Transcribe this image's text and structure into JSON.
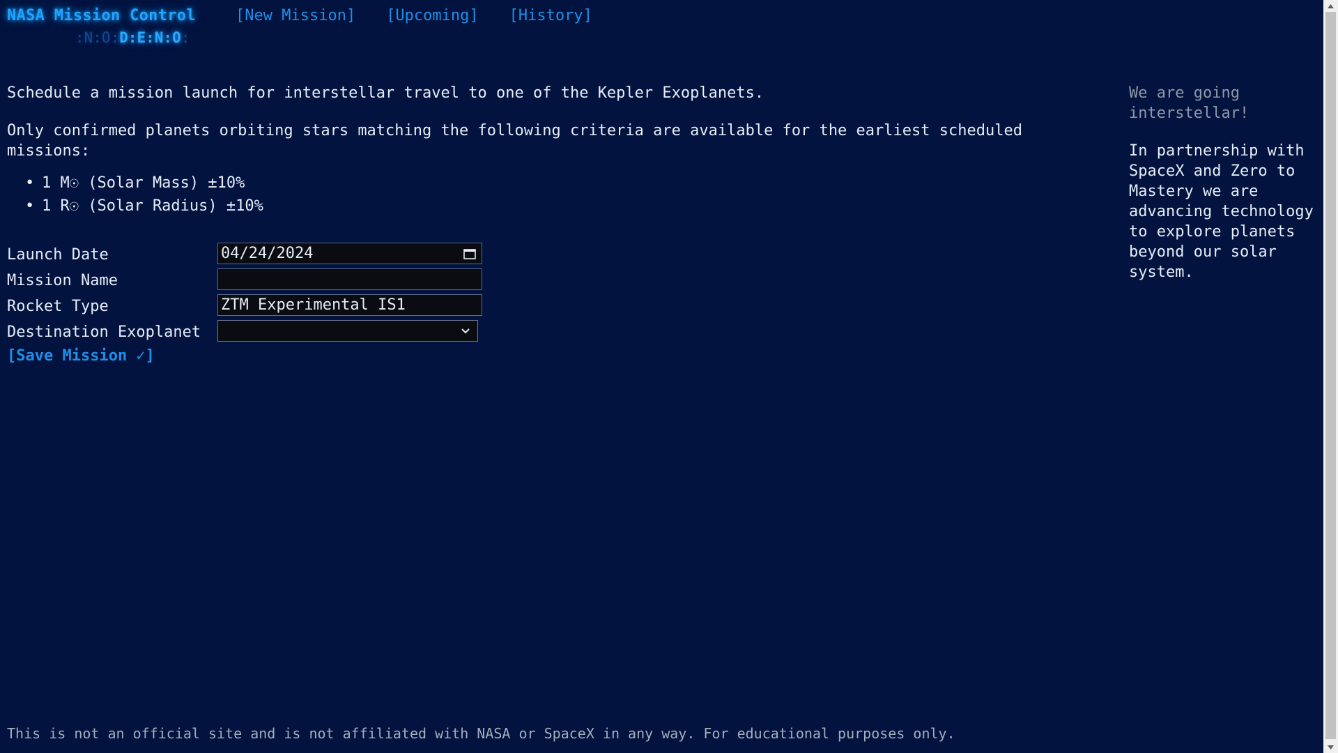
{
  "header": {
    "brand": "NASA Mission Control",
    "brand_sub_dim": ":N:O:",
    "brand_sub_bright": "D:E:N:O",
    "brand_sub_dim_end": ":",
    "nav": [
      {
        "label": "[New Mission]"
      },
      {
        "label": "[Upcoming]"
      },
      {
        "label": "[History]"
      }
    ]
  },
  "main": {
    "intro": "Schedule a mission launch for interstellar travel to one of the Kepler Exoplanets.",
    "criteria_intro": "Only confirmed planets orbiting stars matching the following criteria are available for the earliest scheduled missions:",
    "criteria": [
      {
        "bullet": "•",
        "text": "1 M☉ (Solar Mass) ±10%"
      },
      {
        "bullet": "•",
        "text": "1 R☉ (Solar Radius) ±10%"
      }
    ]
  },
  "form": {
    "launch_date": {
      "label": "Launch Date",
      "value": "04/24/2024",
      "icon": "calendar-icon"
    },
    "mission_name": {
      "label": "Mission Name",
      "value": "",
      "placeholder": ""
    },
    "rocket_type": {
      "label": "Rocket Type",
      "value": "ZTM Experimental IS1"
    },
    "destination": {
      "label": "Destination Exoplanet",
      "value": "",
      "icon": "chevron-down-icon"
    },
    "save_label": "[Save Mission ✓]"
  },
  "aside": {
    "heading": "We are going interstellar!",
    "body": "In partnership with SpaceX and Zero to Mastery we are advancing technology to explore planets beyond our solar system."
  },
  "footer": {
    "text": "This is not an official site and is not affiliated with NASA or SpaceX in any way. For educational purposes only."
  },
  "colors": {
    "background": "#02133f",
    "accent": "#1f8fe6",
    "glow": "#1ea3ff"
  }
}
